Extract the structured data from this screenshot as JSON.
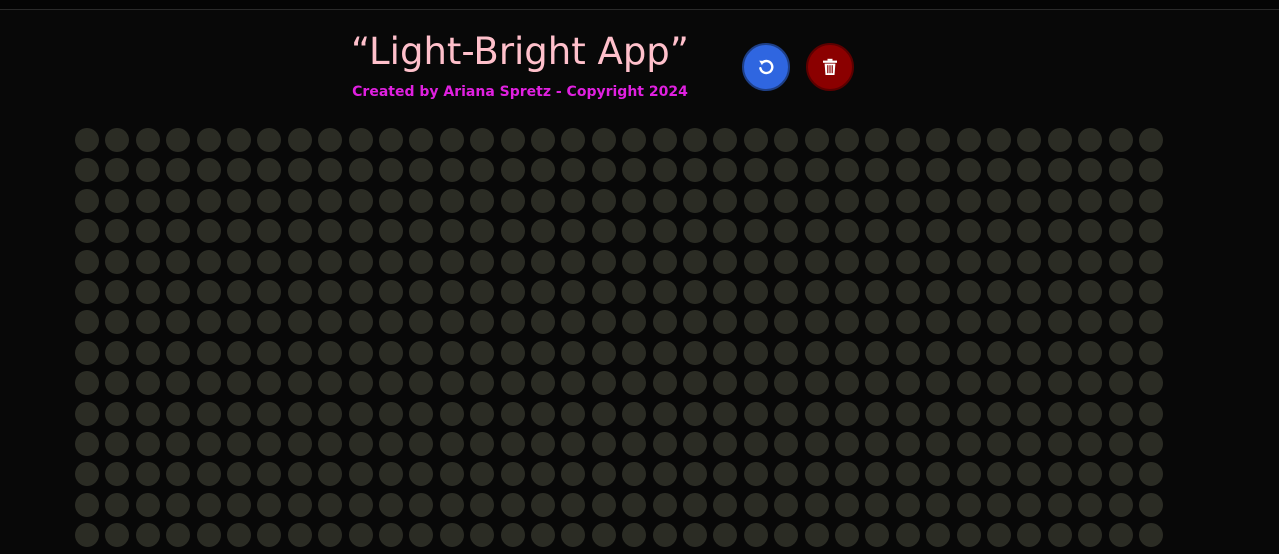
{
  "header": {
    "title": "“Light-Bright App”",
    "subtitle": "Created by Ariana Spretz - Copyright 2024"
  },
  "toolbar": {
    "undo_icon": "undo-icon",
    "clear_icon": "trash-icon",
    "undo_color": "#2f66e0",
    "clear_color": "#8b0000"
  },
  "board": {
    "columns": 36,
    "visible_rows": 14,
    "peg_color": "#2b2c24",
    "background": "#080808"
  }
}
